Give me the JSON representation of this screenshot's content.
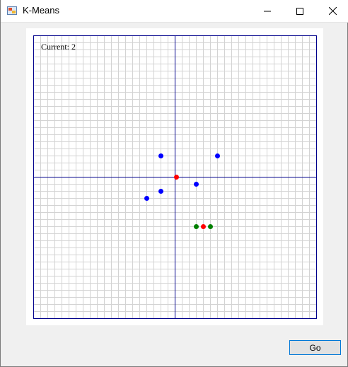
{
  "window": {
    "title": "K-Means",
    "controls": [
      "minimize",
      "maximize",
      "close"
    ]
  },
  "plot": {
    "status_label": "Current: 2",
    "axes_color": "#00008b",
    "grid_color": "#d3d3d3",
    "background": "#ffffff",
    "grid_divisions": 40,
    "x_range": [
      -20,
      20
    ],
    "y_range": [
      -20,
      20
    ],
    "points": [
      {
        "x": -2,
        "y": 3,
        "color": "#0000ff",
        "kind": "data"
      },
      {
        "x": 6,
        "y": 3,
        "color": "#0000ff",
        "kind": "data"
      },
      {
        "x": 0.2,
        "y": 0,
        "color": "#ff0000",
        "kind": "centroid"
      },
      {
        "x": 3,
        "y": -1,
        "color": "#0000ff",
        "kind": "data"
      },
      {
        "x": -2,
        "y": -2,
        "color": "#0000ff",
        "kind": "data"
      },
      {
        "x": -4,
        "y": -3,
        "color": "#0000ff",
        "kind": "data"
      },
      {
        "x": 3,
        "y": -7,
        "color": "#008000",
        "kind": "data"
      },
      {
        "x": 4,
        "y": -7,
        "color": "#ff0000",
        "kind": "centroid"
      },
      {
        "x": 5,
        "y": -7,
        "color": "#008000",
        "kind": "data"
      }
    ]
  },
  "buttons": {
    "go_label": "Go"
  }
}
